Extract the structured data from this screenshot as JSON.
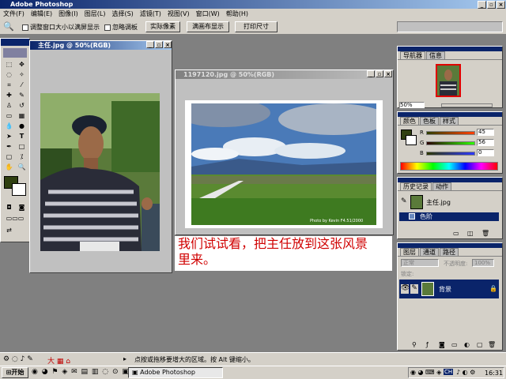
{
  "app": {
    "title": "Adobe Photoshop"
  },
  "menu": [
    "文件(F)",
    "编辑(E)",
    "图像(I)",
    "图层(L)",
    "选择(S)",
    "滤镜(T)",
    "视图(V)",
    "窗口(W)",
    "帮助(H)"
  ],
  "options": {
    "resize_label": "调整窗口大小以满屏显示",
    "ignore_palettes_label": "忽略调板",
    "actual_pixels": "实际像素",
    "fit_on_screen": "满画布显示",
    "print_size": "打印尺寸"
  },
  "doc1": {
    "title": "主任.jpg @ 50%(RGB)"
  },
  "doc2": {
    "title": "1197120.jpg @ 50%(RGB)",
    "photo_credit": "Photo by Kevin F4.51/2000"
  },
  "caption": {
    "line1": "我们试试看，把主任放到这张风景",
    "line2": "里来。"
  },
  "navigator": {
    "tabs": [
      "导航器",
      "信息"
    ],
    "zoom": "50%"
  },
  "color": {
    "tabs": [
      "颜色",
      "色板",
      "样式"
    ],
    "r": "45",
    "g": "56",
    "b": "0",
    "r_label": "R",
    "g_label": "G",
    "b_label": "B"
  },
  "history": {
    "tabs": [
      "历史记录",
      "动作"
    ],
    "items": [
      "主任.jpg",
      "色阶"
    ]
  },
  "layers": {
    "tabs": [
      "图层",
      "通道",
      "路径"
    ],
    "blend": "正常",
    "opacity_label": "不透明度:",
    "opacity": "100%",
    "lock_label": "锁定:",
    "layer_name": "背景"
  },
  "status": {
    "hint": "点按或拖移要增大的区域。按 Alt 键缩小。"
  },
  "taskbar": {
    "start": "开始",
    "task": "Adobe Photoshop",
    "clock": "16:31",
    "ch": "CH"
  },
  "colors": {
    "foreground": "#2f3f10",
    "title_active": "#0a246a",
    "caption_text": "#d00000"
  }
}
